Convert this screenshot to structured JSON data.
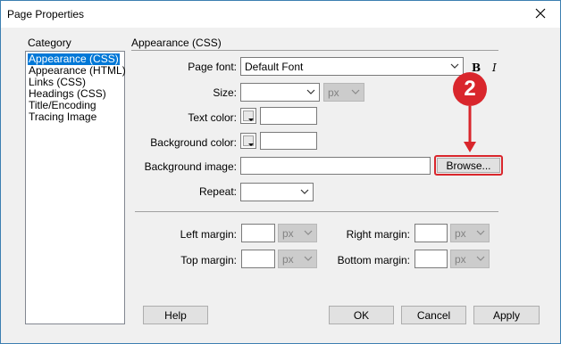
{
  "window": {
    "title": "Page Properties"
  },
  "category": {
    "label": "Category",
    "items": [
      "Appearance (CSS)",
      "Appearance (HTML)",
      "Links (CSS)",
      "Headings (CSS)",
      "Title/Encoding",
      "Tracing Image"
    ],
    "selected": "Appearance (CSS)"
  },
  "section": {
    "title": "Appearance (CSS)"
  },
  "form": {
    "page_font_label": "Page font:",
    "page_font_value": "Default Font",
    "bold_glyph": "B",
    "italic_glyph": "I",
    "size_label": "Size:",
    "size_value": "",
    "size_unit": "px",
    "text_color_label": "Text color:",
    "text_color_value": "",
    "bg_color_label": "Background color:",
    "bg_color_value": "",
    "bg_image_label": "Background image:",
    "bg_image_value": "",
    "browse_label": "Browse...",
    "repeat_label": "Repeat:",
    "repeat_value": ""
  },
  "margins": {
    "left_label": "Left margin:",
    "right_label": "Right margin:",
    "top_label": "Top margin:",
    "bottom_label": "Bottom margin:",
    "unit": "px"
  },
  "buttons": {
    "help": "Help",
    "ok": "OK",
    "cancel": "Cancel",
    "apply": "Apply"
  },
  "annotation": {
    "step_number": "2",
    "color": "#d9262c"
  }
}
